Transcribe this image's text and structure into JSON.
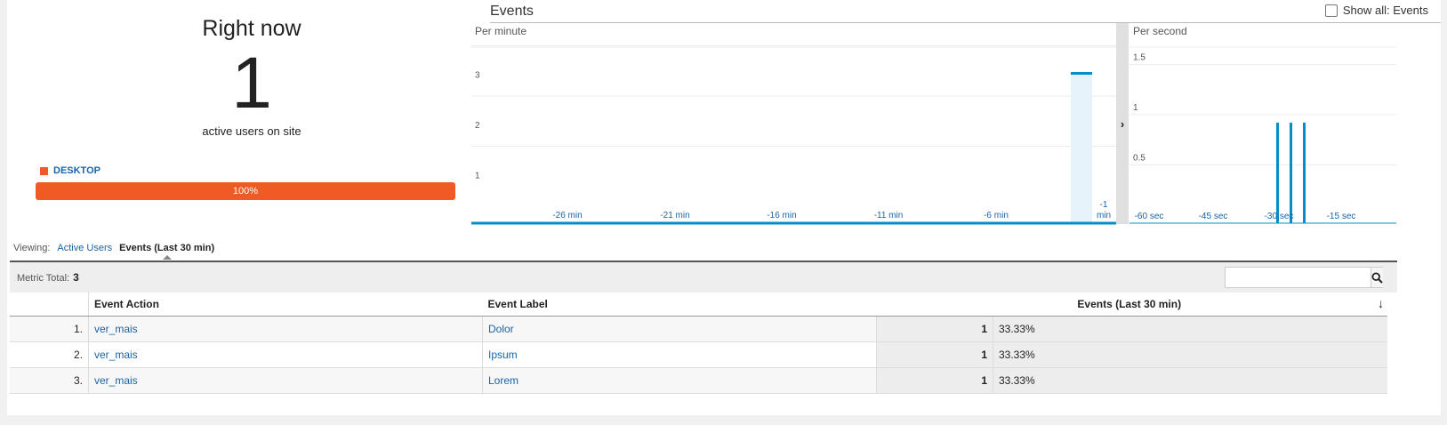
{
  "right_now": {
    "title": "Right now",
    "count": "1",
    "subtitle": "active users on site",
    "device_label": "DESKTOP",
    "device_percent_label": "100%",
    "device_share": 1.0,
    "device_color": "#f05a24"
  },
  "events": {
    "title": "Events",
    "show_all_label": "Show all: Events",
    "show_all_checked": false
  },
  "chart_data": [
    {
      "type": "bar",
      "subtitle": "Per minute",
      "x_tick_labels": [
        "-26 min",
        "-21 min",
        "-16 min",
        "-11 min",
        "-6 min",
        "-1 min"
      ],
      "y_tick_labels": [
        "1",
        "2",
        "3"
      ],
      "ylim": [
        0,
        3
      ],
      "minutes": [
        -30,
        -29,
        -28,
        -27,
        -26,
        -25,
        -24,
        -23,
        -22,
        -21,
        -20,
        -19,
        -18,
        -17,
        -16,
        -15,
        -14,
        -13,
        -12,
        -11,
        -10,
        -9,
        -8,
        -7,
        -6,
        -5,
        -4,
        -3,
        -2,
        -1,
        0
      ],
      "values": [
        0,
        0,
        0,
        0,
        0,
        0,
        0,
        0,
        0,
        0,
        0,
        0,
        0,
        0,
        0,
        0,
        0,
        0,
        0,
        0,
        0,
        0,
        0,
        0,
        0,
        0,
        0,
        0,
        3,
        0,
        0
      ],
      "bar_color": "#058dc7"
    },
    {
      "type": "bar",
      "subtitle": "Per second",
      "x_tick_labels": [
        "-60 sec",
        "-45 sec",
        "-30 sec",
        "-15 sec"
      ],
      "y_tick_labels": [
        "0.5",
        "1",
        "1.5"
      ],
      "ylim": [
        0,
        2
      ],
      "seconds": [
        -30,
        -27,
        -24
      ],
      "values": [
        1,
        1,
        1
      ],
      "bar_color": "#058dc7"
    }
  ],
  "viewing": {
    "label": "Viewing:",
    "tabs": [
      {
        "label": "Active Users",
        "active": false
      },
      {
        "label": "Events (Last 30 min)",
        "active": true
      }
    ]
  },
  "table": {
    "metric_total_label": "Metric Total:",
    "metric_total_value": "3",
    "search_placeholder": "",
    "columns": [
      "Event Action",
      "Event Label",
      "Events (Last 30 min)"
    ],
    "rows": [
      {
        "index": "1.",
        "action": "ver_mais",
        "label": "Dolor",
        "events": "1",
        "percent": "33.33%"
      },
      {
        "index": "2.",
        "action": "ver_mais",
        "label": "Ipsum",
        "events": "1",
        "percent": "33.33%"
      },
      {
        "index": "3.",
        "action": "ver_mais",
        "label": "Lorem",
        "events": "1",
        "percent": "33.33%"
      }
    ]
  }
}
